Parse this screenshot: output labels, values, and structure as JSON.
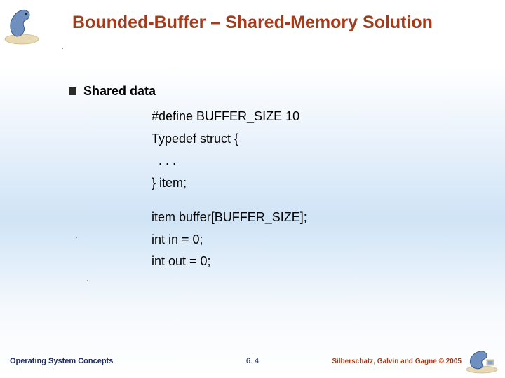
{
  "title": "Bounded-Buffer – Shared-Memory Solution",
  "bullet": {
    "label": "Shared data"
  },
  "code": {
    "l1": "#define BUFFER_SIZE 10",
    "l2": "Typedef struct {",
    "l3": "  . . .",
    "l4": "} item;",
    "l5": "item buffer[BUFFER_SIZE];",
    "l6": "int in = 0;",
    "l7": "int out = 0;"
  },
  "footer": {
    "left": "Operating System Concepts",
    "center": "6. 4",
    "right": "Silberschatz, Galvin and Gagne © 2005"
  }
}
